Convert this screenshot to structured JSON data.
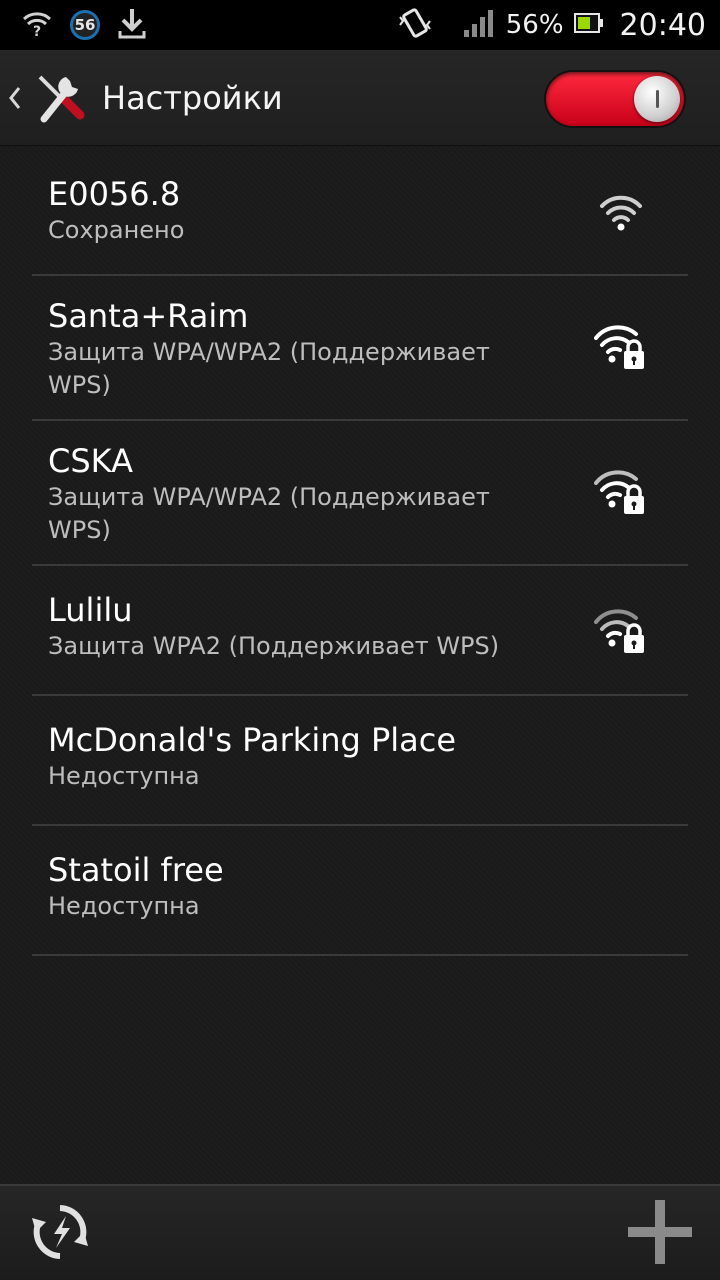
{
  "status_bar": {
    "notification_badge": "56",
    "battery_percent": "56%",
    "time": "20:40",
    "icons": [
      "wifi-question-icon",
      "badge-56-icon",
      "download-icon",
      "vibrate-icon",
      "signal-icon",
      "battery-icon"
    ]
  },
  "action_bar": {
    "title": "Настройки",
    "wifi_toggle_on": true,
    "accent_color": "#e8102a"
  },
  "networks": [
    {
      "name": "E0056.8",
      "status": "Сохранено",
      "signal_icon": "wifi-open-icon",
      "locked": false
    },
    {
      "name": "Santa+Raim",
      "status": "Защита WPA/WPA2 (Поддерживает WPS)",
      "signal_icon": "wifi-locked-icon",
      "locked": true
    },
    {
      "name": "CSKA",
      "status": "Защита WPA/WPA2 (Поддерживает WPS)",
      "signal_icon": "wifi-locked-icon",
      "locked": true
    },
    {
      "name": "Lulilu",
      "status": "Защита WPA2 (Поддерживает WPS)",
      "signal_icon": "wifi-locked-icon",
      "locked": true
    },
    {
      "name": "McDonald's Parking Place",
      "status": "Недоступна",
      "signal_icon": "",
      "locked": false
    },
    {
      "name": "Statoil free",
      "status": "Недоступна",
      "signal_icon": "",
      "locked": false
    }
  ],
  "bottom_bar": {
    "left_icon": "wps-refresh-icon",
    "right_icon": "add-icon"
  }
}
